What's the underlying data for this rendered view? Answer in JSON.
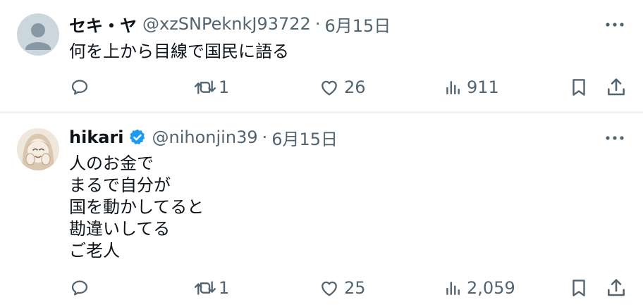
{
  "tweets": [
    {
      "display_name": "セキ・ヤ",
      "handle": "@xzSNPeknkJ93722",
      "separator": "·",
      "date": "6月15日",
      "verified": false,
      "text": "何を上から目線で国民に語る",
      "replies": "",
      "retweets": "1",
      "likes": "26",
      "views": "911"
    },
    {
      "display_name": "hikari",
      "handle": "@nihonjin39",
      "separator": "·",
      "date": "6月15日",
      "verified": true,
      "text": "人のお金で\nまるで自分が\n国を動かしてると\n勘違いしてる\nご老人",
      "replies": "",
      "retweets": "1",
      "likes": "25",
      "views": "2,059"
    }
  ],
  "icons": {
    "reply": "reply-icon",
    "retweet": "retweet-icon",
    "like": "heart-icon",
    "views": "views-chart-icon",
    "bookmark": "bookmark-icon",
    "share": "share-icon",
    "more": "more-dots-icon",
    "verified": "verified-badge-icon"
  },
  "colors": {
    "text_primary": "#0f1419",
    "text_secondary": "#536471",
    "verified_blue": "#1d9bf0",
    "separator": "#eff3f4"
  }
}
